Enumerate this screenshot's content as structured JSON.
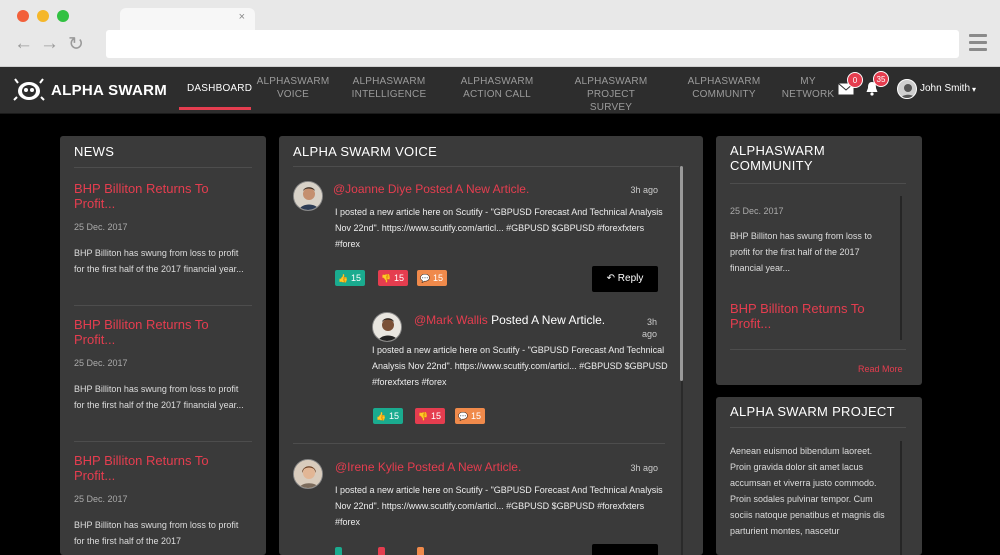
{
  "browser": {
    "tab_close": "×",
    "back": "←",
    "forward": "→",
    "reload": "↻"
  },
  "header": {
    "brand": "ALPHA SWARM",
    "nav": [
      {
        "line1": "DASHBOARD",
        "line2": ""
      },
      {
        "line1": "ALPHASWARM",
        "line2": "VOICE"
      },
      {
        "line1": "ALPHASWARM",
        "line2": "INTELLIGENCE"
      },
      {
        "line1": "ALPHASWARM",
        "line2": "ACTION CALL"
      },
      {
        "line1": "ALPHASWARM",
        "line2": "PROJECT SURVEY"
      },
      {
        "line1": "ALPHASWARM",
        "line2": "COMMUNITY"
      },
      {
        "line1": "MY",
        "line2": "NETWORK"
      }
    ],
    "messages_count": "0",
    "notifications_count": "35",
    "user_name": "John Smith",
    "caret": "▾"
  },
  "news": {
    "title": "NEWS",
    "items": [
      {
        "title": "BHP Billiton Returns To Profit...",
        "date": "25 Dec. 2017",
        "text": "BHP Billiton has swung from loss to profit for the first half of the 2017 financial year..."
      },
      {
        "title": "BHP Billiton Returns To Profit...",
        "date": "25 Dec. 2017",
        "text": "BHP Billiton has swung from loss to profit for the first half of the 2017 financial year..."
      },
      {
        "title": "BHP Billiton Returns To Profit...",
        "date": "25 Dec. 2017",
        "text": "BHP Billiton has swung from loss to profit for the first half of the 2017"
      }
    ]
  },
  "voice": {
    "title": "ALPHA SWARM VOICE",
    "posts": [
      {
        "user": "@Joanne Diye",
        "action": "Posted A New Article.",
        "time": "3h ago",
        "text": "I posted a new article here on Scutify - \"GBPUSD Forecast And Technical Analysis Nov 22nd\". https://www.scutify.com/articl... #GBPUSD $GBPUSD #forexfxters #forex",
        "likes": "15",
        "dislikes": "15",
        "comments": "15",
        "reply": "Reply"
      },
      {
        "user": "@Mark Wallis",
        "action": "Posted A New Article.",
        "time": "3h ago",
        "text": "I posted a new article here on Scutify - \"GBPUSD Forecast And Technical Analysis Nov 22nd\". https://www.scutify.com/articl... #GBPUSD $GBPUSD #forexfxters #forex",
        "likes": "15",
        "dislikes": "15",
        "comments": "15"
      },
      {
        "user": "@Irene Kylie",
        "action": "Posted A New Article.",
        "time": "3h ago",
        "text": "I posted a new article here on Scutify - \"GBPUSD Forecast And Technical Analysis Nov 22nd\". https://www.scutify.com/articl... #GBPUSD $GBPUSD #forexfxters #forex"
      }
    ]
  },
  "community": {
    "title": "ALPHASWARM COMMUNITY",
    "date": "25 Dec. 2017",
    "text": "BHP Billiton has swung from loss to profit for the first half of the 2017 financial year...",
    "link_title": "BHP Billiton Returns To Profit...",
    "read_more": "Read More"
  },
  "project": {
    "title": "ALPHA SWARM PROJECT",
    "text": "Aenean euismod bibendum laoreet. Proin gravida dolor sit amet lacus accumsan et viverra justo commodo. Proin sodales pulvinar tempor. Cum sociis natoque penatibus et magnis dis parturient montes, nascetur"
  },
  "colors": {
    "accent": "#e53d4f",
    "like": "#1aab8f",
    "comment": "#f08a4b",
    "panel": "#3a3a3a"
  }
}
